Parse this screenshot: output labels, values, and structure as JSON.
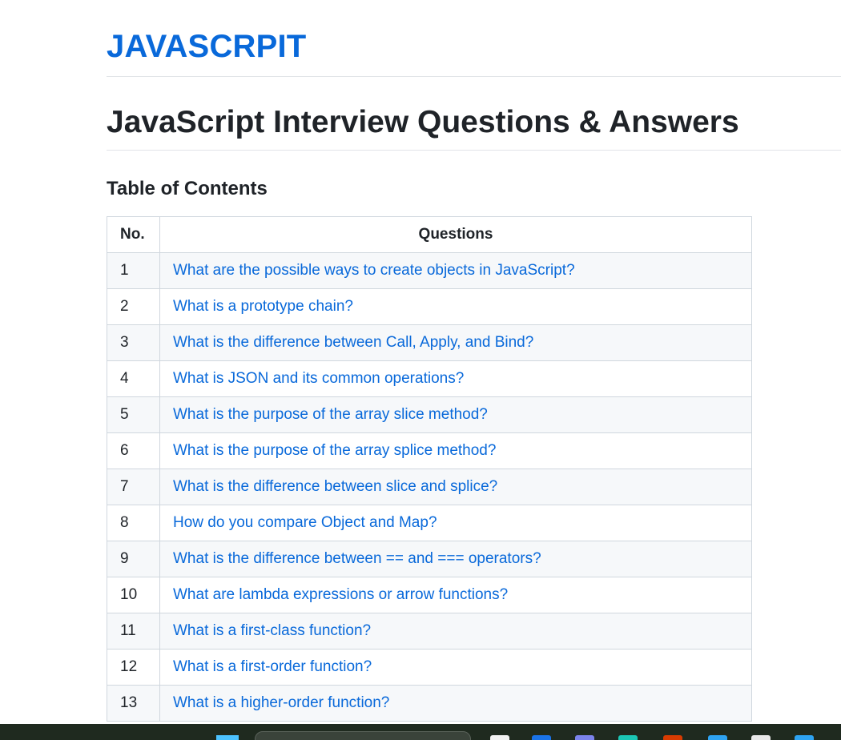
{
  "site": {
    "title": "JAVASCRPIT"
  },
  "page": {
    "title": "JavaScript Interview Questions & Answers"
  },
  "toc": {
    "heading": "Table of Contents",
    "headers": {
      "no": "No.",
      "questions": "Questions"
    },
    "rows": [
      {
        "no": "1",
        "question": "What are the possible ways to create objects in JavaScript?"
      },
      {
        "no": "2",
        "question": "What is a prototype chain?"
      },
      {
        "no": "3",
        "question": "What is the difference between Call, Apply, and Bind?"
      },
      {
        "no": "4",
        "question": "What is JSON and its common operations?"
      },
      {
        "no": "5",
        "question": "What is the purpose of the array slice method?"
      },
      {
        "no": "6",
        "question": "What is the purpose of the array splice method?"
      },
      {
        "no": "7",
        "question": "What is the difference between slice and splice?"
      },
      {
        "no": "8",
        "question": "How do you compare Object and Map?"
      },
      {
        "no": "9",
        "question": "What is the difference between == and === operators?"
      },
      {
        "no": "10",
        "question": "What are lambda expressions or arrow functions?"
      },
      {
        "no": "11",
        "question": "What is a first-class function?"
      },
      {
        "no": "12",
        "question": "What is a first-order function?"
      },
      {
        "no": "13",
        "question": "What is a higher-order function?"
      }
    ]
  },
  "colors": {
    "link": "#0969da",
    "text": "#1f2328",
    "border": "#d0d7de",
    "stripe": "#f6f8fa"
  },
  "taskbar": {
    "apps": [
      {
        "icon": "file-explorer-icon",
        "color": "#f2f2f2"
      },
      {
        "icon": "outlook-icon",
        "color": "#1a73e8"
      },
      {
        "icon": "teams-icon",
        "color": "#7b83eb"
      },
      {
        "icon": "edge-icon",
        "color": "#1bc6b4"
      },
      {
        "icon": "office-icon",
        "color": "#d83b01"
      },
      {
        "icon": "browser-icon",
        "color": "#2ea3f2"
      },
      {
        "icon": "chrome-icon",
        "color": "#e8e8e8"
      },
      {
        "icon": "store-icon",
        "color": "#2ea3f2"
      }
    ]
  }
}
